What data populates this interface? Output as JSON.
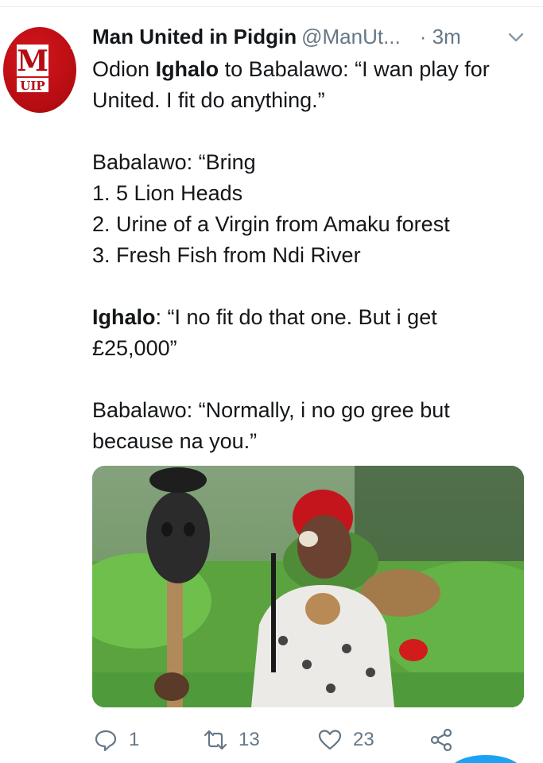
{
  "tweet": {
    "author": {
      "display_name": "Man United in Pidgin",
      "handle": "@ManUt...",
      "avatar_letters": "M",
      "avatar_sub": "UIP"
    },
    "time": "· 3m",
    "body_lines": [
      {
        "pre": "Odion ",
        "bold": "Ighalo",
        "post": " to Babalawo: “I wan play for"
      },
      {
        "pre": "United. I fit do anything.”",
        "bold": "",
        "post": ""
      },
      null,
      {
        "pre": "Babalawo: “Bring",
        "bold": "",
        "post": ""
      },
      {
        "pre": "1. 5 Lion Heads",
        "bold": "",
        "post": ""
      },
      {
        "pre": "2. Urine of a Virgin from Amaku forest",
        "bold": "",
        "post": ""
      },
      {
        "pre": "3. Fresh Fish from Ndi River",
        "bold": "",
        "post": ""
      },
      null,
      {
        "pre": "",
        "bold": "Ighalo",
        "post": ": “I no fit do that one. But i get"
      },
      {
        "pre": "£25,000”",
        "bold": "",
        "post": ""
      },
      null,
      {
        "pre": "Babalawo: “Normally, i no go gree but",
        "bold": "",
        "post": ""
      },
      {
        "pre": "because na you.”",
        "bold": "",
        "post": ""
      }
    ],
    "stats": {
      "replies": "1",
      "retweets": "13",
      "likes": "23"
    }
  },
  "colors": {
    "text": "#14171a",
    "secondary": "#657786",
    "avatar_red": "#c8141b",
    "accent": "#1da1f2"
  },
  "icons": {
    "caret": "chevron-down-icon",
    "reply": "reply-icon",
    "retweet": "retweet-icon",
    "like": "heart-icon",
    "share": "share-icon"
  }
}
